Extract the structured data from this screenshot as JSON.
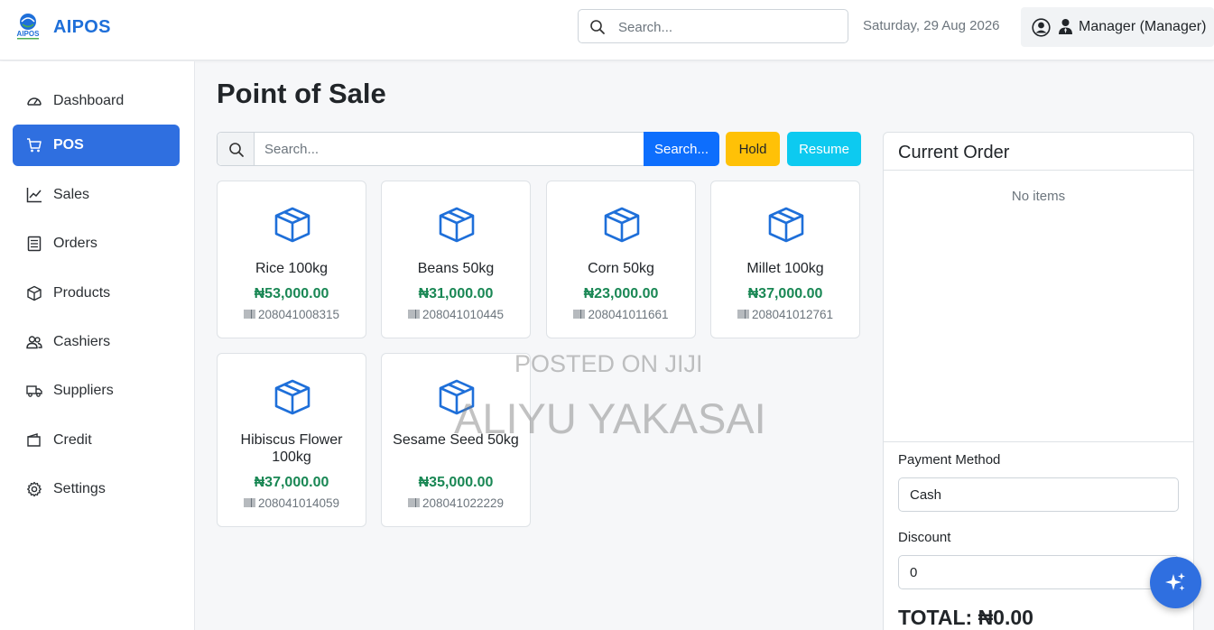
{
  "header": {
    "brand": "AIPOS",
    "logo_text": "AIPOS",
    "search_placeholder": "Search...",
    "date": "Saturday, 29 Aug 2026",
    "user": "Manager (Manager)"
  },
  "sidebar": {
    "items": [
      {
        "label": "Dashboard",
        "icon": "gauge-icon"
      },
      {
        "label": "POS",
        "icon": "cart-icon",
        "active": true
      },
      {
        "label": "Sales",
        "icon": "chart-line-icon"
      },
      {
        "label": "Orders",
        "icon": "receipt-icon"
      },
      {
        "label": "Products",
        "icon": "box-icon"
      },
      {
        "label": "Cashiers",
        "icon": "people-icon"
      },
      {
        "label": "Suppliers",
        "icon": "truck-icon"
      },
      {
        "label": "Credit",
        "icon": "wallet-icon"
      },
      {
        "label": "Settings",
        "icon": "gear-icon"
      }
    ]
  },
  "main": {
    "title": "Point of Sale",
    "search_placeholder": "Search...",
    "search_button": "Search...",
    "hold_button": "Hold",
    "resume_button": "Resume",
    "products": [
      {
        "name": "Rice 100kg",
        "price": "₦53,000.00",
        "code": "208041008315"
      },
      {
        "name": "Beans 50kg",
        "price": "₦31,000.00",
        "code": "208041010445"
      },
      {
        "name": "Corn 50kg",
        "price": "₦23,000.00",
        "code": "208041011661"
      },
      {
        "name": "Millet 100kg",
        "price": "₦37,000.00",
        "code": "208041012761"
      },
      {
        "name": "Hibiscus Flower 100kg",
        "price": "₦37,000.00",
        "code": "208041014059"
      },
      {
        "name": "Sesame Seed 50kg",
        "price": "₦35,000.00",
        "code": "208041022229"
      }
    ]
  },
  "order": {
    "title": "Current Order",
    "empty_text": "No items",
    "payment_label": "Payment Method",
    "payment_value": "Cash",
    "discount_label": "Discount",
    "discount_value": "0",
    "total": "TOTAL: ₦0.00"
  },
  "watermark": {
    "line1": "POSTED ON JIJI",
    "line2": "ALIYU YAKASAI"
  },
  "colors": {
    "primary": "#2f6fe0",
    "search_button": "#0d6efd",
    "hold": "#ffc107",
    "resume": "#0dcaf0",
    "price": "#198754"
  }
}
